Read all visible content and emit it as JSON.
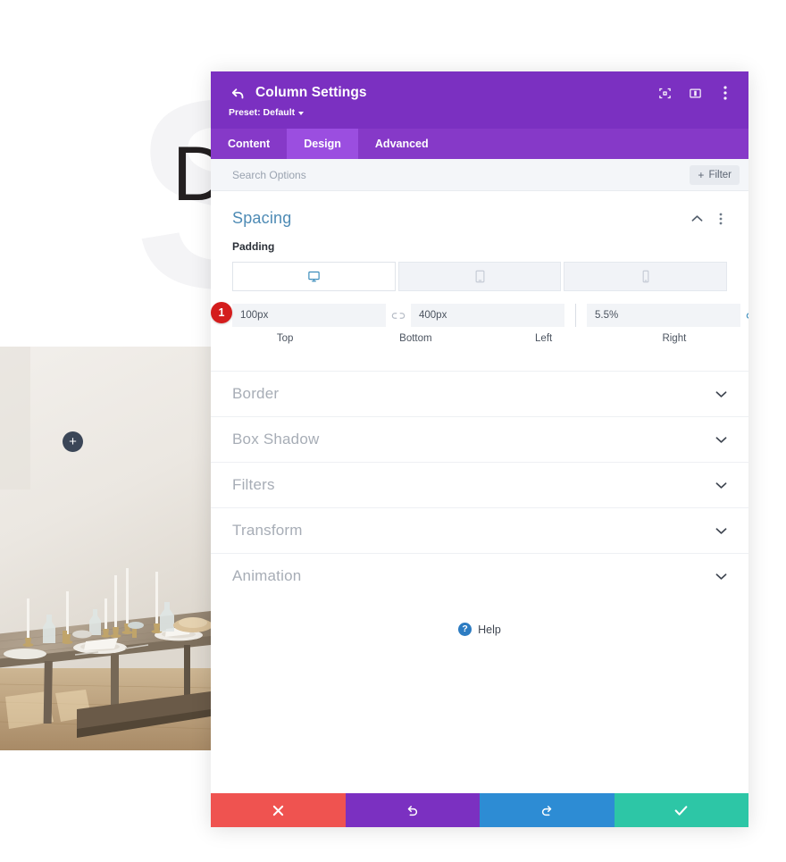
{
  "background": {
    "watermark_text": "SP",
    "headline_text": "Dynamic",
    "add_button_label": "+",
    "photo_alt": "rustic-dining-table-photo"
  },
  "modal": {
    "header": {
      "back_icon": "back-arrow-icon",
      "title": "Column Settings",
      "preset_label": "Preset: Default",
      "icons": [
        {
          "name": "focus-target-icon"
        },
        {
          "name": "layout-panel-icon"
        },
        {
          "name": "more-options-icon"
        }
      ]
    },
    "tabs": [
      {
        "label": "Content",
        "active": false
      },
      {
        "label": "Design",
        "active": true
      },
      {
        "label": "Advanced",
        "active": false
      }
    ],
    "search": {
      "value": "",
      "placeholder": "Search Options",
      "filter_label": "Filter",
      "filter_plus": "+"
    },
    "spacing_section": {
      "title": "Spacing",
      "collapse_icon": "chevron-up-icon",
      "menu_icon": "more-options-icon",
      "padding_label": "Padding",
      "device_tabs": [
        {
          "name": "desktop-icon",
          "active": true
        },
        {
          "name": "tablet-icon",
          "active": false
        },
        {
          "name": "phone-icon",
          "active": false
        }
      ],
      "badge": "1",
      "fields": [
        {
          "side": "Top",
          "value": "100px",
          "name": "padding-top-input"
        },
        {
          "side": "Bottom",
          "value": "400px",
          "name": "padding-bottom-input"
        },
        {
          "side": "Left",
          "value": "5.5%",
          "name": "padding-left-input"
        },
        {
          "side": "Right",
          "value": "5.5%",
          "name": "padding-right-input"
        }
      ],
      "link_left": {
        "name": "link-broken-icon",
        "linked": false
      },
      "link_right": {
        "name": "link-connected-icon",
        "linked": true
      }
    },
    "accordion_sections": [
      {
        "label": "Border"
      },
      {
        "label": "Box Shadow"
      },
      {
        "label": "Filters"
      },
      {
        "label": "Transform"
      },
      {
        "label": "Animation"
      }
    ],
    "help": {
      "icon_glyph": "?",
      "label": "Help"
    },
    "footer_buttons": [
      {
        "name": "cancel-button",
        "icon": "close-icon"
      },
      {
        "name": "undo-button",
        "icon": "undo-icon"
      },
      {
        "name": "redo-button",
        "icon": "redo-icon"
      },
      {
        "name": "save-button",
        "icon": "check-icon"
      }
    ]
  },
  "colors": {
    "header_purple": "#7b30c1",
    "tabbar_purple": "#8639c8",
    "tab_active_purple": "#9b4ee0",
    "section_title_blue": "#4e8bb5",
    "badge_red": "#d41d1d",
    "cancel_red": "#ef5350",
    "redo_blue": "#2d8cd4",
    "save_teal": "#2dc6a6",
    "accent_blue": "#3c8dbc"
  }
}
